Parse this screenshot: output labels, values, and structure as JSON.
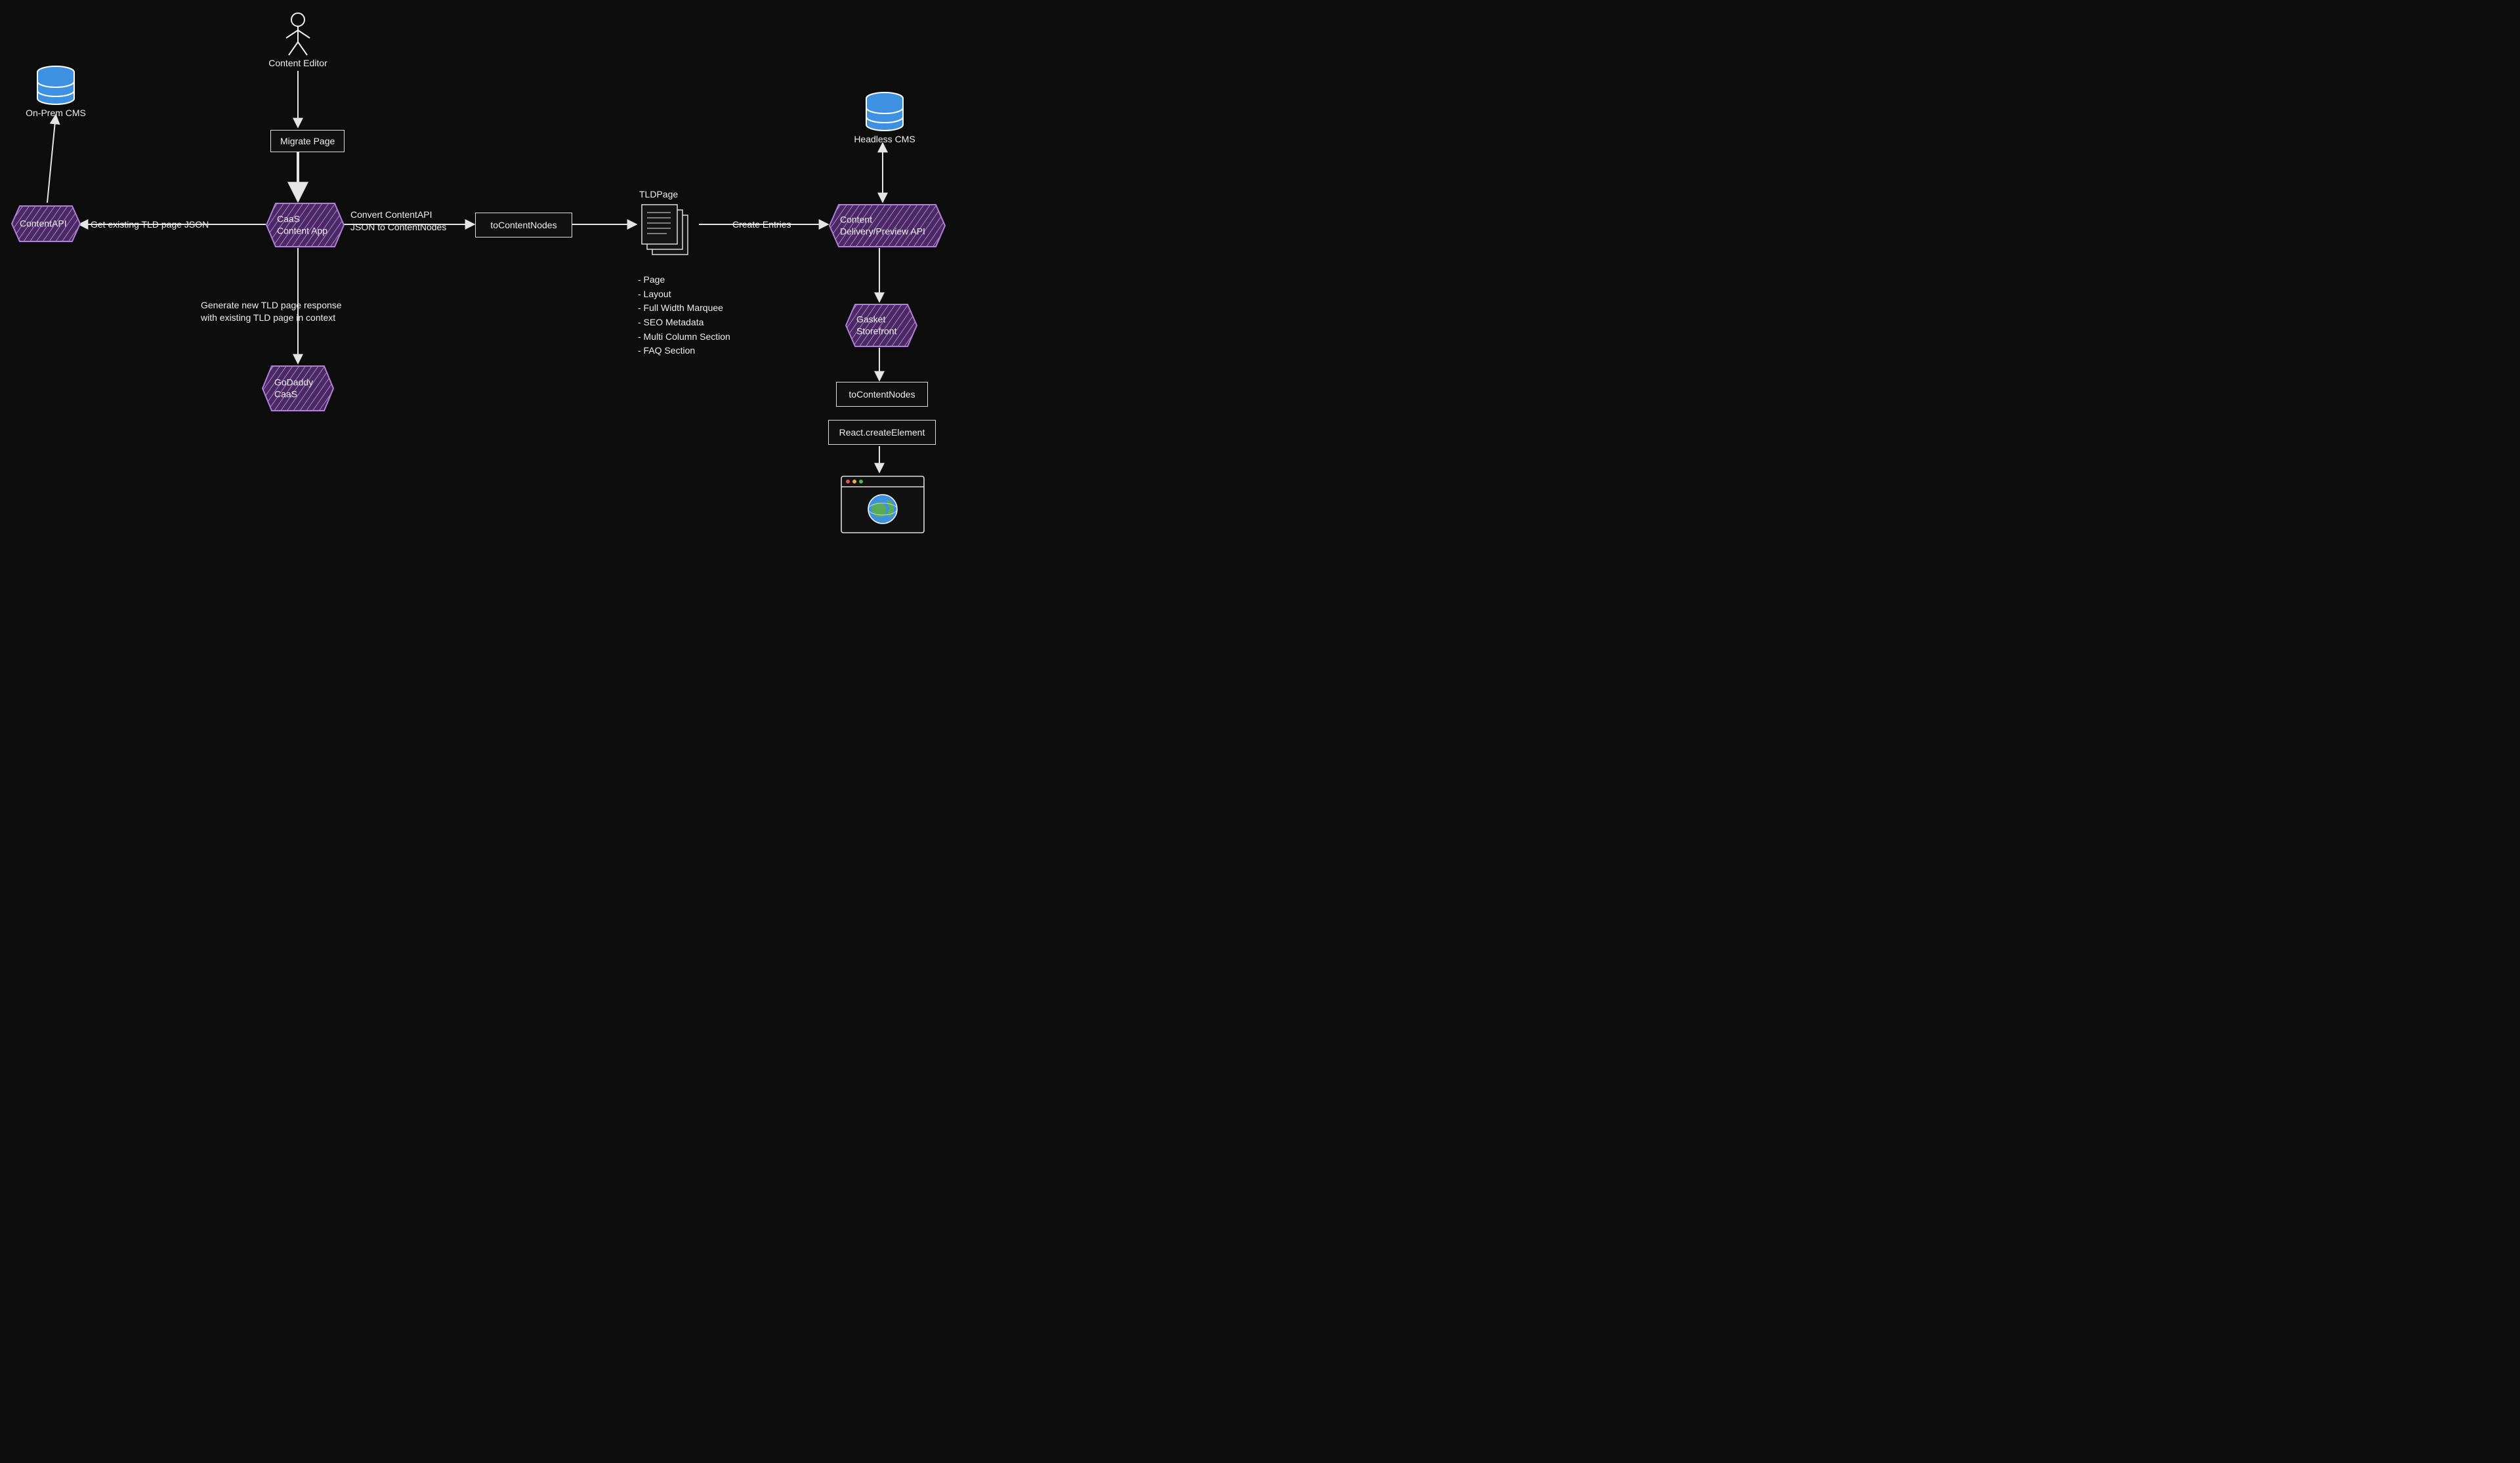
{
  "colors": {
    "hexFill": "#b07fd8",
    "dbFill": "#3e90e0",
    "stroke": "#e5e5e5",
    "globeFill": "#5baa56"
  },
  "actor": {
    "label": "Content Editor"
  },
  "db_onprem": {
    "label": "On-Prem CMS"
  },
  "db_headless": {
    "label": "Headless CMS"
  },
  "hex_contentapi": {
    "text": "ContentAPI"
  },
  "hex_caas_app": {
    "text": "CaaS\nContent App"
  },
  "hex_godaddy": {
    "text": "GoDaddy\nCaaS"
  },
  "hex_cdapi": {
    "text": "Content\nDelivery/Preview API"
  },
  "hex_gasket": {
    "text": "Gasket\nStorefront"
  },
  "rect_migrate": {
    "text": "Migrate Page"
  },
  "rect_tocontentnodes1": {
    "text": "toContentNodes"
  },
  "rect_tocontentnodes2": {
    "text": "toContentNodes"
  },
  "rect_react": {
    "text": "React.createElement"
  },
  "docstack": {
    "title": "TLDPage",
    "items": [
      "- Page",
      "- Layout",
      "- Full Width Marquee",
      "- SEO Metadata",
      "- Multi Column Section",
      "- FAQ Section"
    ]
  },
  "edge_get_json": "Get existing TLD page JSON",
  "edge_convert": "Convert ContentAPI\nJSON to ContentNodes",
  "edge_create_entries": "Create Entries",
  "edge_generate": "Generate new TLD page response\nwith existing TLD page in context"
}
